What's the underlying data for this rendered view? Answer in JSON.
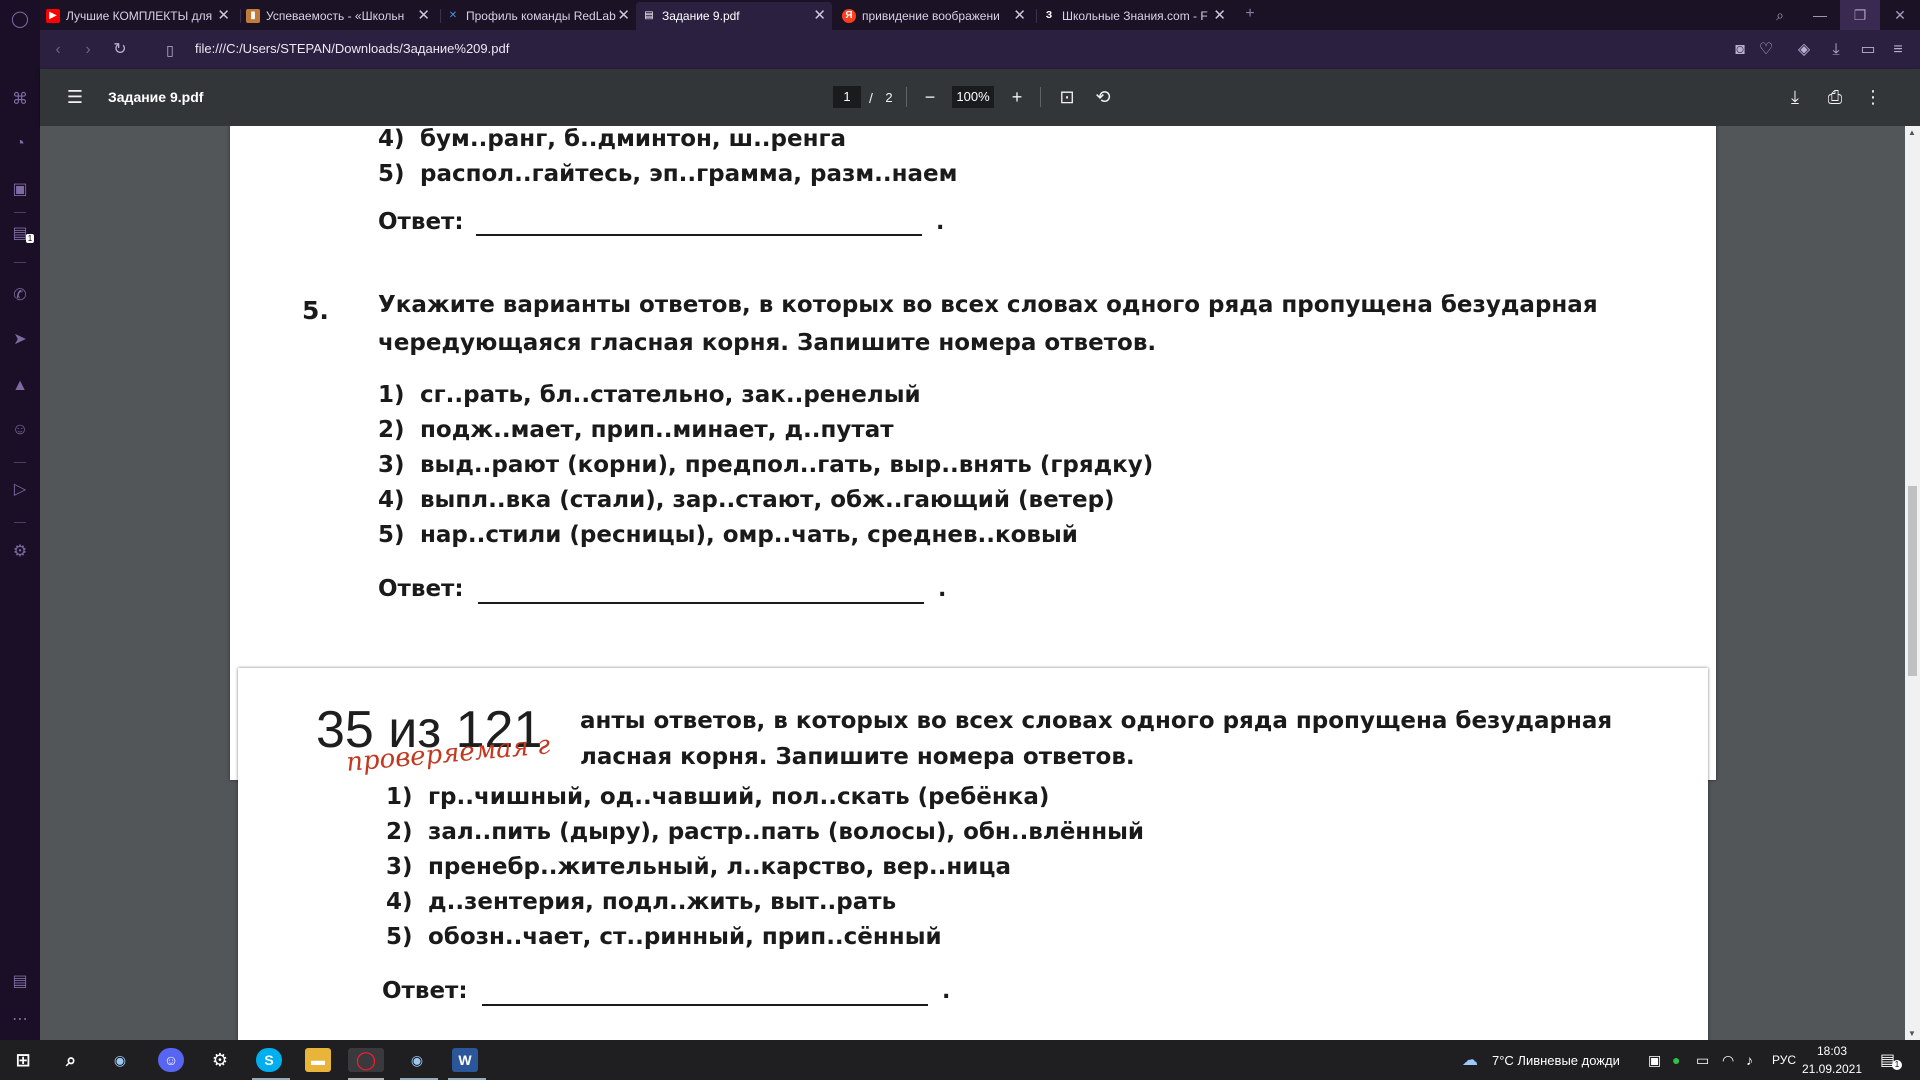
{
  "browser": {
    "tabs": [
      {
        "title": "Лучшие КОМПЛЕКТЫ для",
        "favicon": "youtube-icon",
        "color": "#ff0000",
        "glyph": "▶"
      },
      {
        "title": "Успеваемость - «Школьн",
        "favicon": "school-icon",
        "color": "#c07a3a",
        "glyph": "▮"
      },
      {
        "title": "Профиль команды RedLab",
        "favicon": "x-logo-icon",
        "color": "#4a90e2",
        "glyph": "✕"
      },
      {
        "title": "Задание 9.pdf",
        "favicon": "pdf-file-icon",
        "color": "#ffffff",
        "glyph": "▤"
      },
      {
        "title": "привидение воображени",
        "favicon": "yandex-icon",
        "color": "#fc3f1d",
        "glyph": "Я"
      },
      {
        "title": "Школьные Знания.com - F",
        "favicon": "znania-icon",
        "color": "#1b1226",
        "glyph": "З"
      }
    ],
    "new_tab": "+",
    "url": "file:///C:/Users/STEPAN/Downloads/Задание%209.pdf",
    "sidebar_badge": "1"
  },
  "pdf": {
    "title": "Задание 9.pdf",
    "current_page": "1",
    "page_sep": "/",
    "total_pages": "2",
    "zoom": "100%"
  },
  "page1": {
    "lines_top": [
      {
        "n": "4)",
        "t": "бум..ранг, б..дминтон, ш..ренга"
      },
      {
        "n": "5)",
        "t": "распол..гайтесь, эп..грамма, разм..наем"
      }
    ],
    "answer_label": "Ответ:",
    "task_number": "5.",
    "task_line1": "Укажите варианты ответов, в которых во всех словах одного ряда пропущена безударная",
    "task_line2": "чередующаяся гласная корня. Запишите номера ответов.",
    "options": [
      {
        "n": "1)",
        "t": "сг..рать, бл..стательно, зак..ренелый"
      },
      {
        "n": "2)",
        "t": "подж..мает, прип..минает, д..путат"
      },
      {
        "n": "3)",
        "t": "выд..рают (корни), предпол..гать, выр..внять (грядку)"
      },
      {
        "n": "4)",
        "t": "выпл..вка (стали), зар..стают, обж..гающий (ветер)"
      },
      {
        "n": "5)",
        "t": "нар..стили (ресницы), омр..чать, среднев..ковый"
      }
    ]
  },
  "page2": {
    "task_line1": "анты ответов, в которых во всех словах одного ряда пропущена безударная",
    "task_line2": "ласная корня. Запишите номера ответов.",
    "options": [
      {
        "n": "1)",
        "t": "гр..чишный, од..чавший, пол..скать (ребёнка)"
      },
      {
        "n": "2)",
        "t": "зал..пить (дыру), растр..пать (волосы), обн..влённый"
      },
      {
        "n": "3)",
        "t": "пренебр..жительный, л..карство, вер..ница"
      },
      {
        "n": "4)",
        "t": "д..зентерия, подл..жить, выт..рать"
      },
      {
        "n": "5)",
        "t": "обозн..чает, ст..ринный, прип..сённый"
      }
    ],
    "answer_label": "Ответ:"
  },
  "overlay": {
    "count": "35 из 121",
    "note": "проверяемая г"
  },
  "taskbar": {
    "weather": "7°C  Ливневые дожди",
    "lang": "РУС",
    "time": "18:03",
    "date": "21.09.2021",
    "notif_count": "1"
  }
}
